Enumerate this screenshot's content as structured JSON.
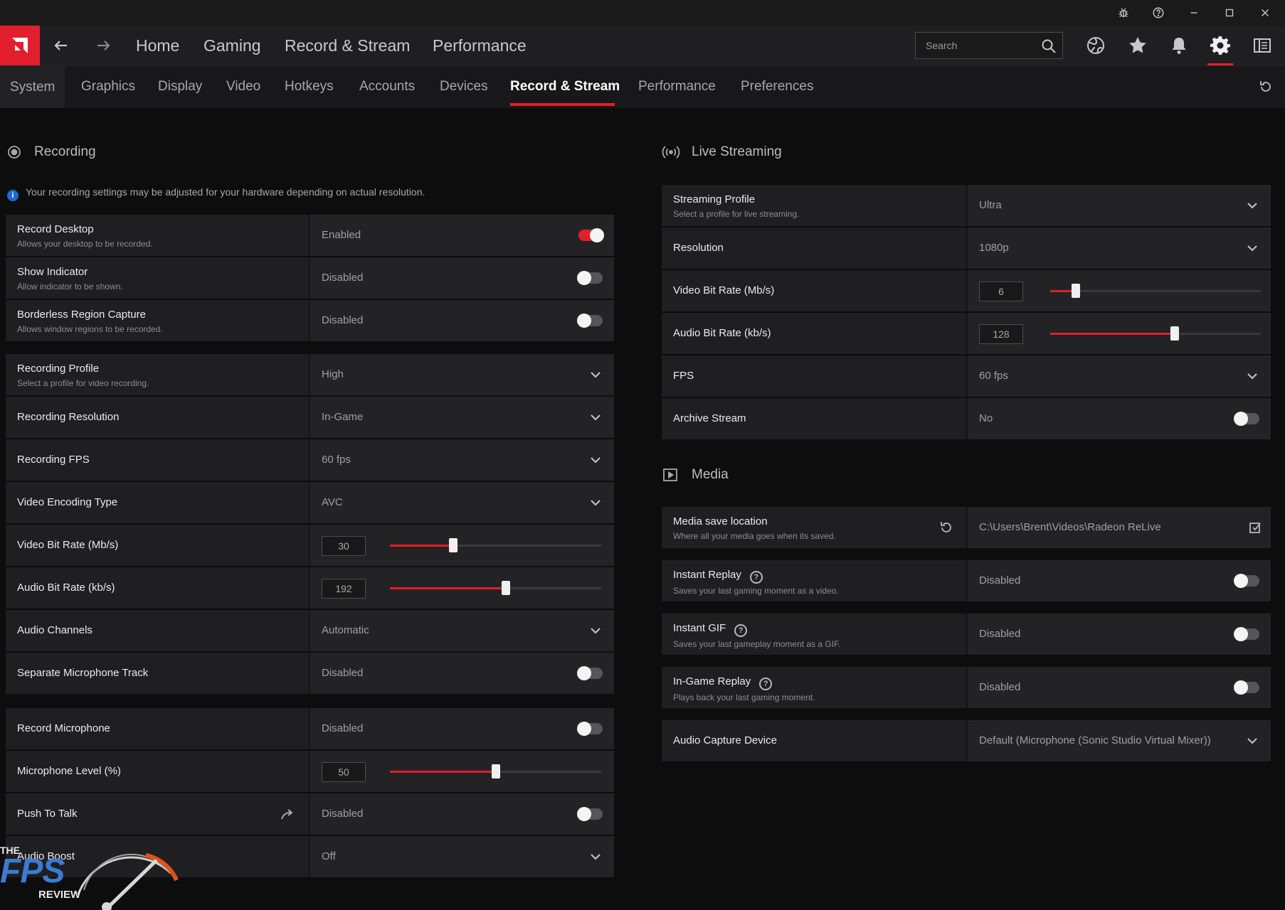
{
  "titlebar": {
    "icons": [
      "bug-icon",
      "help-icon",
      "minimize-icon",
      "maximize-icon",
      "close-icon"
    ]
  },
  "nav": {
    "links": [
      "Home",
      "Gaming",
      "Record & Stream",
      "Performance"
    ],
    "search_placeholder": "Search"
  },
  "subnav": {
    "tabs": [
      "System",
      "Graphics",
      "Display",
      "Video",
      "Hotkeys",
      "Accounts",
      "Devices",
      "Record & Stream",
      "Performance",
      "Preferences"
    ],
    "active": "Record & Stream"
  },
  "recording": {
    "title": "Recording",
    "info": "Your recording settings may be adjusted for your hardware depending on actual resolution.",
    "record_desktop": {
      "label": "Record Desktop",
      "sub": "Allows your desktop to be recorded.",
      "value": "Enabled"
    },
    "show_indicator": {
      "label": "Show Indicator",
      "sub": "Allow indicator to be shown.",
      "value": "Disabled"
    },
    "borderless": {
      "label": "Borderless Region Capture",
      "sub": "Allows window regions to be recorded.",
      "value": "Disabled"
    },
    "profile": {
      "label": "Recording Profile",
      "sub": "Select a profile for video recording.",
      "value": "High"
    },
    "resolution": {
      "label": "Recording Resolution",
      "value": "In-Game"
    },
    "fps": {
      "label": "Recording FPS",
      "value": "60 fps"
    },
    "encoding": {
      "label": "Video Encoding Type",
      "value": "AVC"
    },
    "video_bitrate": {
      "label": "Video Bit Rate (Mb/s)",
      "value": "30",
      "level": 0.3
    },
    "audio_bitrate": {
      "label": "Audio Bit Rate (kb/s)",
      "value": "192",
      "level": 0.55
    },
    "audio_channels": {
      "label": "Audio Channels",
      "value": "Automatic"
    },
    "separate_mic": {
      "label": "Separate Microphone Track",
      "value": "Disabled"
    },
    "record_mic": {
      "label": "Record Microphone",
      "value": "Disabled"
    },
    "mic_level": {
      "label": "Microphone Level (%)",
      "value": "50",
      "level": 0.5
    },
    "push_to_talk": {
      "label": "Push To Talk",
      "value": "Disabled"
    },
    "audio_boost": {
      "label": "Audio Boost",
      "value": "Off"
    }
  },
  "streaming": {
    "title": "Live Streaming",
    "profile": {
      "label": "Streaming Profile",
      "sub": "Select a profile for live streaming.",
      "value": "Ultra"
    },
    "resolution": {
      "label": "Resolution",
      "value": "1080p"
    },
    "video_bitrate": {
      "label": "Video Bit Rate (Mb/s)",
      "value": "6",
      "level": 0.12
    },
    "audio_bitrate": {
      "label": "Audio Bit Rate (kb/s)",
      "value": "128",
      "level": 0.59
    },
    "fps": {
      "label": "FPS",
      "value": "60 fps"
    },
    "archive": {
      "label": "Archive Stream",
      "value": "No"
    }
  },
  "media": {
    "title": "Media",
    "save_location": {
      "label": "Media save location",
      "sub": "Where all your media goes when its saved.",
      "value": "C:\\Users\\Brent\\Videos\\Radeon ReLive"
    },
    "instant_replay": {
      "label": "Instant Replay",
      "sub": "Saves your last gaming moment as a video.",
      "value": "Disabled"
    },
    "instant_gif": {
      "label": "Instant GIF",
      "sub": "Saves your last gameplay moment as a GIF.",
      "value": "Disabled"
    },
    "ingame_replay": {
      "label": "In-Game Replay",
      "sub": "Plays back your last gaming moment.",
      "value": "Disabled"
    },
    "audio_capture": {
      "label": "Audio Capture Device",
      "value": "Default (Microphone (Sonic Studio Virtual Mixer))"
    }
  },
  "watermark": {
    "line1": "THE",
    "line2": "FPS",
    "line3": "REVIEW"
  },
  "colors": {
    "accent": "#e31e2d",
    "info": "#1e6ad6"
  }
}
